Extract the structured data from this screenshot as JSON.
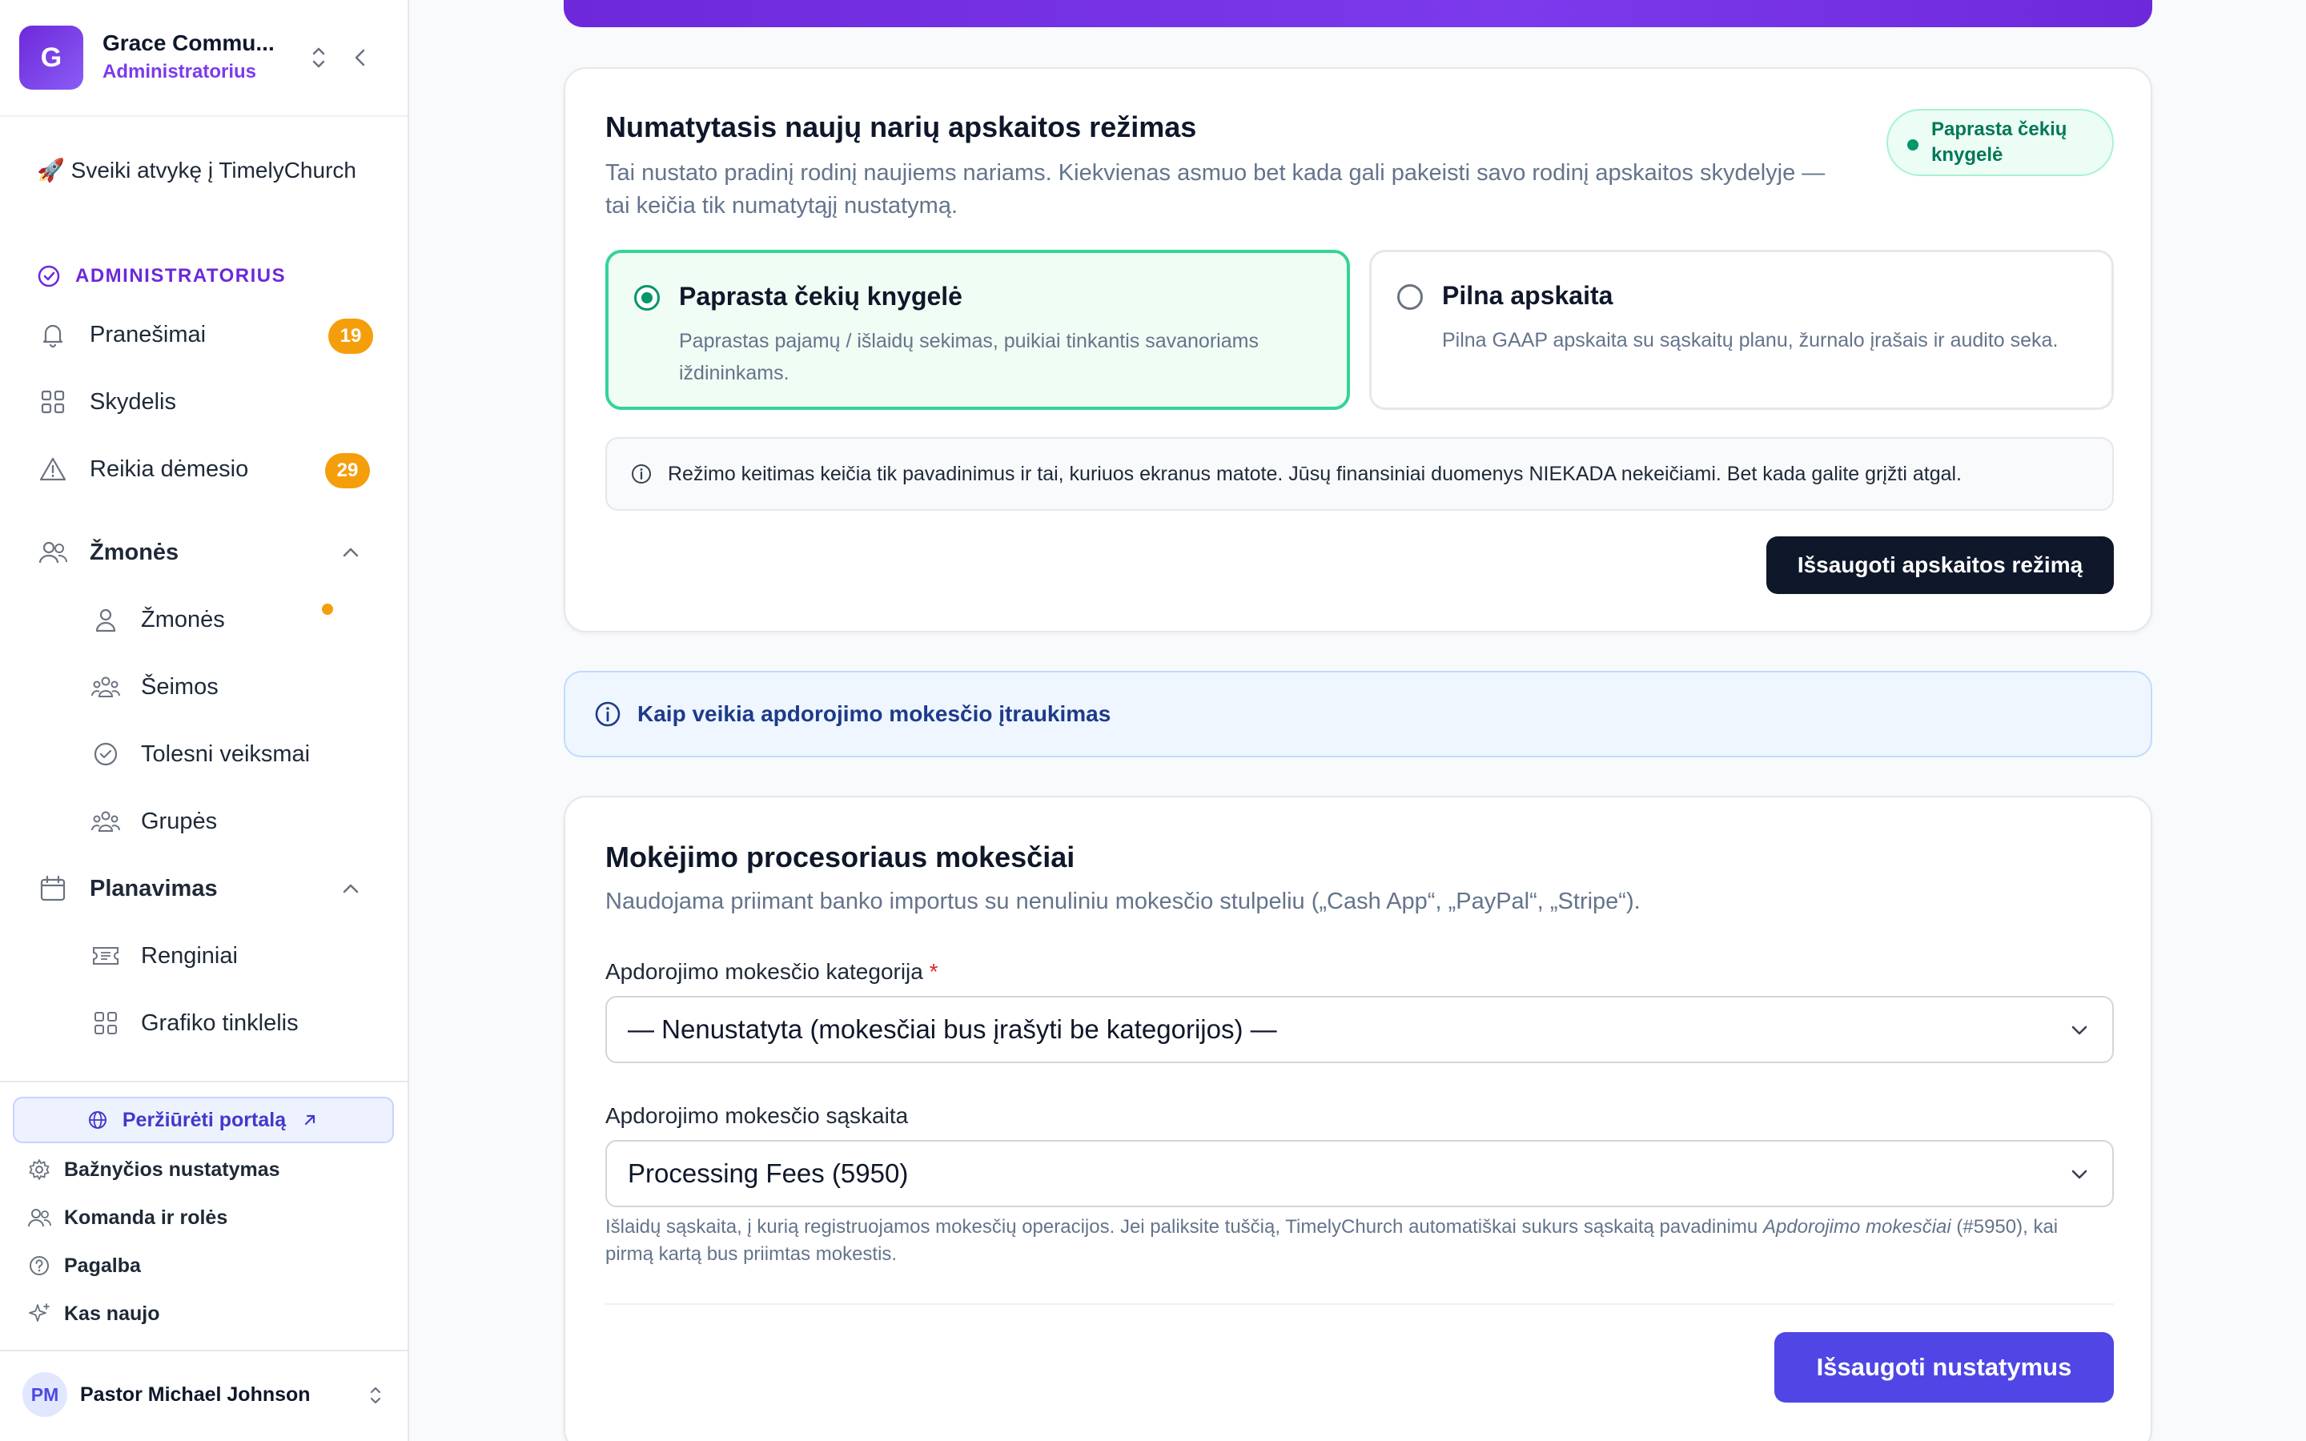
{
  "org": {
    "initial": "G",
    "name": "Grace Commu...",
    "role": "Administratorius"
  },
  "sidebar": {
    "welcome": "🚀 Sveiki atvykę į TimelyChurch",
    "section_label": "ADMINISTRATORIUS",
    "items": [
      {
        "label": "Pranešimai",
        "badge": "19",
        "icon": "bell-icon"
      },
      {
        "label": "Skydelis",
        "icon": "grid-icon"
      },
      {
        "label": "Reikia dėmesio",
        "badge": "29",
        "icon": "warning-icon"
      },
      {
        "label": "Žmonės",
        "icon": "people-icon",
        "expanded": true
      },
      {
        "label": "Planavimas",
        "icon": "calendar-icon",
        "expanded": true
      }
    ],
    "people_sub": [
      {
        "label": "Žmonės",
        "icon": "user-icon"
      },
      {
        "label": "Šeimos",
        "icon": "family-icon"
      },
      {
        "label": "Tolesni veiksmai",
        "icon": "check-circle-icon"
      },
      {
        "label": "Grupės",
        "icon": "groups-icon"
      }
    ],
    "planning_sub": [
      {
        "label": "Renginiai",
        "icon": "ticket-icon"
      },
      {
        "label": "Grafiko tinklelis",
        "icon": "grid-icon"
      }
    ],
    "portal_button": "Peržiūrėti portalą",
    "footer": [
      {
        "label": "Bažnyčios nustatymas",
        "icon": "gear-icon"
      },
      {
        "label": "Komanda ir rolės",
        "icon": "team-icon"
      },
      {
        "label": "Pagalba",
        "icon": "help-icon"
      },
      {
        "label": "Kas naujo",
        "icon": "sparkle-icon"
      }
    ],
    "user": {
      "initials": "PM",
      "name": "Pastor Michael Johnson"
    }
  },
  "accounting_mode": {
    "title": "Numatytasis naujų narių apskaitos režimas",
    "description": "Tai nustato pradinį rodinį naujiems nariams. Kiekvienas asmuo bet kada gali pakeisti savo rodinį apskaitos skydelyje — tai keičia tik numatytąjį nustatymą.",
    "current_badge": "Paprasta čekių knygelė",
    "options": [
      {
        "title": "Paprasta čekių knygelė",
        "description": "Paprastas pajamų / išlaidų sekimas, puikiai tinkantis savanoriams iždininkams.",
        "selected": true
      },
      {
        "title": "Pilna apskaita",
        "description": "Pilna GAAP apskaita su sąskaitų planu, žurnalo įrašais ir audito seka.",
        "selected": false
      }
    ],
    "note": "Režimo keitimas keičia tik pavadinimus ir tai, kuriuos ekranus matote. Jūsų finansiniai duomenys NIEKADA nekeičiami. Bet kada galite grįžti atgal.",
    "save_button": "Išsaugoti apskaitos režimą"
  },
  "info_bar": {
    "text": "Kaip veikia apdorojimo mokesčio įtraukimas"
  },
  "processor_fees": {
    "title": "Mokėjimo procesoriaus mokesčiai",
    "description": "Naudojama priimant banko importus su nenuliniu mokesčio stulpeliu („Cash App“, „PayPal“, „Stripe“).",
    "category_label": "Apdorojimo mokesčio kategorija",
    "category_required": "*",
    "category_value": "— Nenustatyta (mokesčiai bus įrašyti be kategorijos) —",
    "account_label": "Apdorojimo mokesčio sąskaita",
    "account_value": "Processing Fees (5950)",
    "help_before": "Išlaidų sąskaita, į kurią registruojamos mokesčių operacijos. Jei paliksite tuščią, TimelyChurch automatiškai sukurs sąskaitą pavadinimu ",
    "help_em": "Apdorojimo mokesčiai",
    "help_after": " (#5950), kai pirmą kartą bus priimtas mokestis.",
    "save_button": "Išsaugoti nustatymus"
  },
  "colors": {
    "brand": "#7c3aed",
    "selected_border": "#34d399",
    "badge": "#f59e0b",
    "primary_button": "#4f46e5"
  }
}
